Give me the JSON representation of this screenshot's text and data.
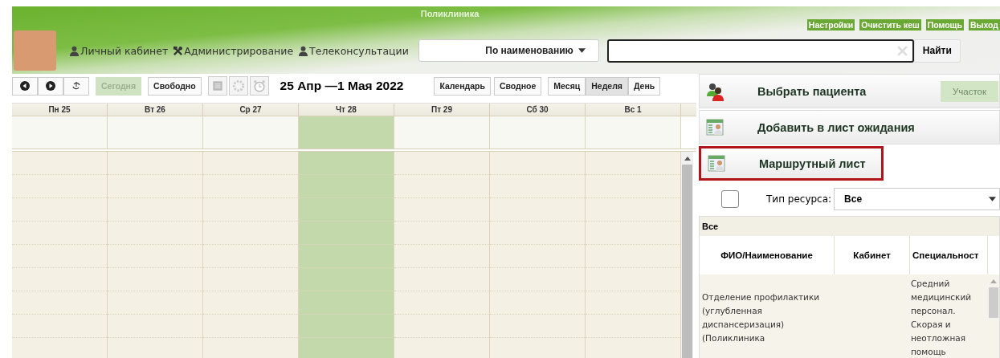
{
  "header": {
    "title": "Поликлиника",
    "links": [
      "Настройки",
      "Очистить кеш",
      "Помощь",
      "Выход"
    ]
  },
  "nav": [
    {
      "label": "Личный кабинет",
      "kind": "person"
    },
    {
      "label": "Администрирование",
      "kind": "tools"
    },
    {
      "label": "Телеконсультации",
      "kind": "person"
    }
  ],
  "search": {
    "mode": "По наименованию",
    "button": "Найти"
  },
  "toolbar": {
    "today": {
      "label": "Сегодня",
      "disabled": true
    },
    "free": "Свободно",
    "range": "25 Апр —1 Мая 2022",
    "views": [
      "Календарь",
      "Сводное"
    ],
    "periods": [
      {
        "label": "Месяц",
        "selected": false
      },
      {
        "label": "Неделя",
        "selected": true
      },
      {
        "label": "День",
        "selected": false
      }
    ]
  },
  "calendar": {
    "days": [
      {
        "label": "Пн 25",
        "selected": false
      },
      {
        "label": "Вт 26",
        "selected": false
      },
      {
        "label": "Ср 27",
        "selected": false
      },
      {
        "label": "Чт 28",
        "selected": true
      },
      {
        "label": "Пт 29",
        "selected": false
      },
      {
        "label": "Сб 30",
        "selected": false
      },
      {
        "label": "Вс 1",
        "selected": false
      }
    ]
  },
  "actions": [
    {
      "label": "Выбрать пациента",
      "kind": "patients",
      "highlighted": false
    },
    {
      "label": "Добавить в лист ожидания",
      "kind": "list",
      "highlighted": false
    },
    {
      "label": "Маршрутный лист",
      "kind": "list",
      "highlighted": true
    }
  ],
  "district_button": {
    "label": "Участок",
    "disabled": true
  },
  "filter": {
    "checked": false,
    "label": "Тип ресурса:",
    "value": "Все"
  },
  "resources": {
    "group": "Все",
    "columns": [
      "ФИО/Наименование",
      "Кабинет",
      "Специальност"
    ],
    "rows": [
      {
        "name": "Отделение профилактики (углубленная диспансеризация) (Поликлиника",
        "specialty": "Средний медицинский персонал. Скорая и неотложная помощь"
      }
    ]
  }
}
